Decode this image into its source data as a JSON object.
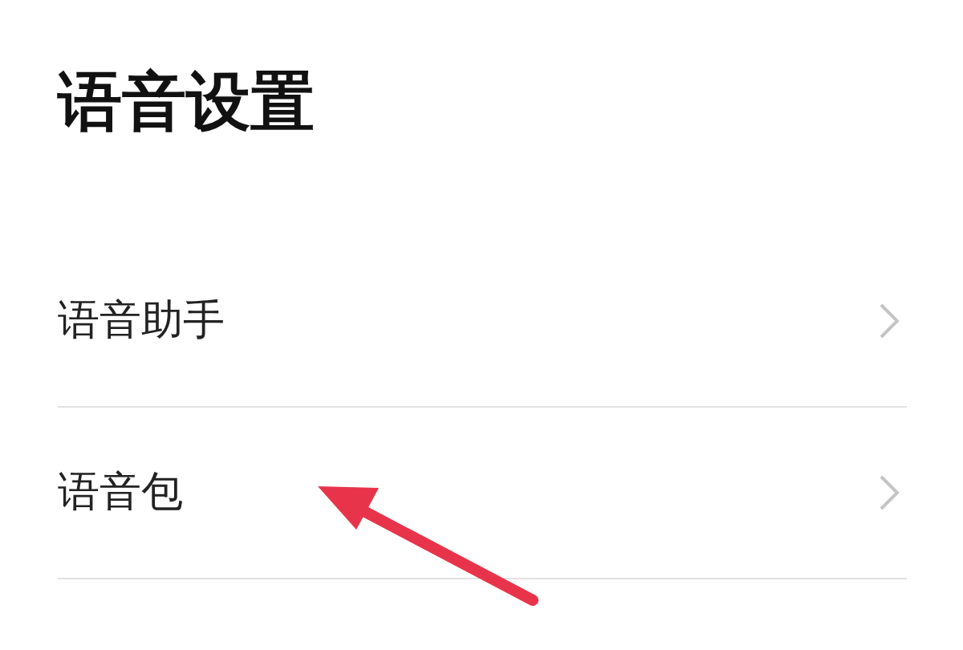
{
  "title": "语音设置",
  "items": [
    {
      "label": "语音助手"
    },
    {
      "label": "语音包"
    }
  ]
}
